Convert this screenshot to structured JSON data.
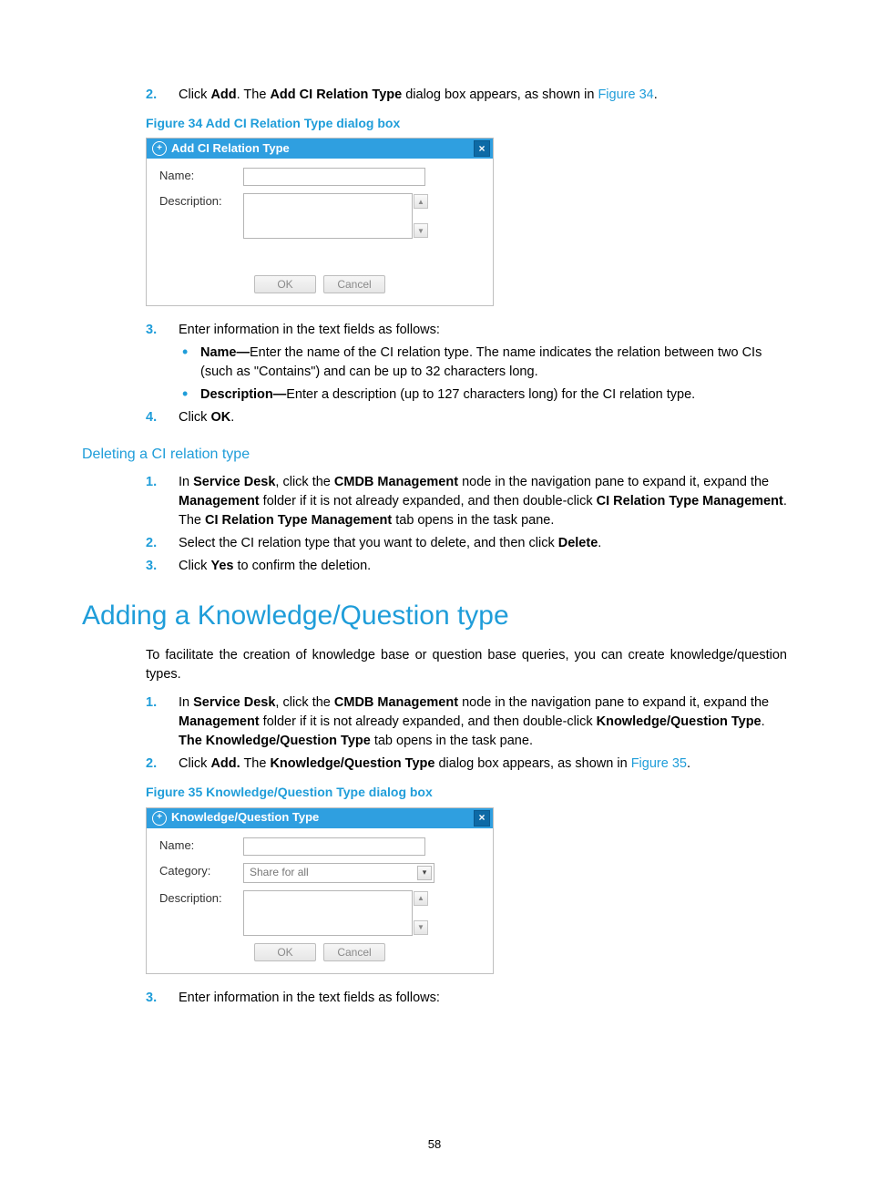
{
  "steps_top": {
    "n2": "2.",
    "s2_click": "Click ",
    "s2_add": "Add",
    "s2_mid": ". The ",
    "s2_dlgname": "Add CI Relation Type",
    "s2_tail": " dialog box appears, as shown in ",
    "s2_link": "Figure 34",
    "s2_end": "."
  },
  "fig34_cap": "Figure 34 Add CI Relation Type dialog box",
  "dlg1": {
    "title": "Add CI Relation Type",
    "name_label": "Name:",
    "desc_label": "Description:",
    "ok": "OK",
    "cancel": "Cancel"
  },
  "steps_mid": {
    "n3": "3.",
    "s3": "Enter information in the text fields as follows:",
    "b1_name": "Name—",
    "b1_txt": "Enter the name of the CI relation type. The name indicates the relation between two CIs (such as \"Contains\") and can be up to 32 characters long.",
    "b2_name": "Description—",
    "b2_txt": "Enter a description (up to 127 characters long) for the CI relation type.",
    "n4": "4.",
    "s4_a": "Click ",
    "s4_b": "OK",
    "s4_c": "."
  },
  "h3_del": "Deleting a CI relation type",
  "del": {
    "n1": "1.",
    "s1_a": "In ",
    "s1_b": "Service Desk",
    "s1_c": ", click the ",
    "s1_d": "CMDB Management",
    "s1_e": " node in the navigation pane to expand it, expand the ",
    "s1_f": "Management",
    "s1_g": " folder if it is not already expanded, and then double-click ",
    "s1_h": "CI Relation Type Management",
    "s1_i": ". The ",
    "s1_j": "CI Relation Type Management",
    "s1_k": " tab opens in the task pane.",
    "n2": "2.",
    "s2_a": "Select the CI relation type that you want to delete, and then click ",
    "s2_b": "Delete",
    "s2_c": ".",
    "n3": "3.",
    "s3_a": "Click ",
    "s3_b": "Yes",
    "s3_c": " to confirm the deletion."
  },
  "h1": "Adding a Knowledge/Question type",
  "intro": "To facilitate the creation of knowledge base or question base queries, you can create knowledge/question types.",
  "kq": {
    "n1": "1.",
    "s1_a": "In ",
    "s1_b": "Service Desk",
    "s1_c": ", click the ",
    "s1_d": "CMDB Management",
    "s1_e": " node in the navigation pane to expand it, expand the ",
    "s1_f": "Management",
    "s1_g": " folder if it is not already expanded, and then double-click ",
    "s1_h": "Knowledge/Question Type",
    "s1_i": ". ",
    "s1_j": "The Knowledge/Question Type",
    "s1_k": " tab opens in the task pane.",
    "n2": "2.",
    "s2_a": "Click ",
    "s2_b": "Add.",
    "s2_c": " The ",
    "s2_d": "Knowledge/Question Type",
    "s2_e": " dialog box appears, as shown in ",
    "s2_link": "Figure 35",
    "s2_end": "."
  },
  "fig35_cap": "Figure 35 Knowledge/Question Type dialog box",
  "dlg2": {
    "title": "Knowledge/Question Type",
    "name_label": "Name:",
    "cat_label": "Category:",
    "cat_value": "Share for all",
    "desc_label": "Description:",
    "ok": "OK",
    "cancel": "Cancel"
  },
  "last": {
    "n3": "3.",
    "s3": "Enter information in the text fields as follows:"
  },
  "pagenum": "58"
}
